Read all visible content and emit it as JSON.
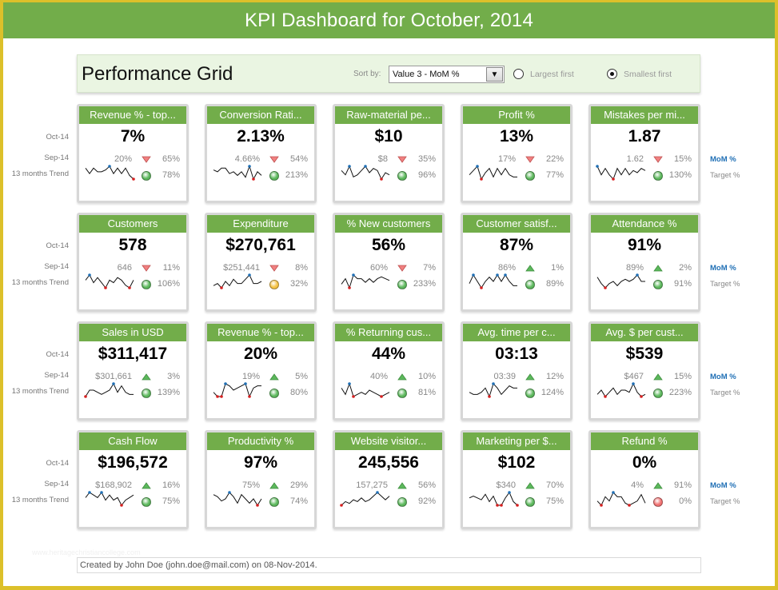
{
  "title": "KPI Dashboard for October, 2014",
  "performance": {
    "title": "Performance Grid",
    "sort_label": "Sort by:",
    "sort_value": "Value 3 - MoM %",
    "options": [
      {
        "label": "Largest first",
        "selected": false
      },
      {
        "label": "Smallest first",
        "selected": true
      }
    ]
  },
  "row_labels": {
    "current": "Oct-14",
    "previous": "Sep-14",
    "trend": "13 months Trend"
  },
  "legend": {
    "mom": "MoM %",
    "target": "Target %"
  },
  "colors": {
    "accent_green": "#72ad4a",
    "up": "#5cb85c",
    "down": "#f08080",
    "target_good": "#5cb85c",
    "target_warn": "#f5c242",
    "target_bad": "#f07070",
    "spark_high": "#1f6fb5",
    "spark_low": "#d62020",
    "frame": "#dcc02a"
  },
  "cards": [
    {
      "title": "Revenue % - top...",
      "value": "7%",
      "previous": "20%",
      "mom_dir": "down",
      "mom": "65%",
      "target_status": "good",
      "target": "78%",
      "trend": [
        6,
        3,
        6,
        4,
        4,
        5,
        7,
        3,
        6,
        3,
        6,
        2,
        0
      ]
    },
    {
      "title": "Conversion Rati...",
      "value": "2.13%",
      "previous": "4.66%",
      "mom_dir": "down",
      "mom": "54%",
      "target_status": "good",
      "target": "213%",
      "trend": [
        5,
        4,
        6,
        6,
        3,
        4,
        2,
        4,
        1,
        7,
        0,
        4,
        2
      ]
    },
    {
      "title": "Raw-material pe...",
      "value": "$10",
      "previous": "$8",
      "mom_dir": "down",
      "mom": "35%",
      "target_status": "good",
      "target": "96%",
      "trend": [
        5,
        3,
        7,
        2,
        3,
        5,
        7,
        4,
        6,
        5,
        1,
        4,
        3
      ]
    },
    {
      "title": "Profit %",
      "value": "13%",
      "previous": "17%",
      "mom_dir": "down",
      "mom": "22%",
      "target_status": "good",
      "target": "77%",
      "trend": [
        3,
        5,
        7,
        1,
        4,
        6,
        2,
        6,
        3,
        6,
        3,
        2,
        2
      ]
    },
    {
      "title": "Mistakes per mi...",
      "value": "1.87",
      "previous": "1.62",
      "mom_dir": "down",
      "mom": "15%",
      "target_status": "good",
      "target": "130%",
      "trend": [
        7,
        3,
        6,
        3,
        1,
        6,
        3,
        6,
        3,
        5,
        4,
        6,
        5
      ]
    },
    {
      "title": "Customers",
      "value": "578",
      "previous": "646",
      "mom_dir": "down",
      "mom": "11%",
      "target_status": "good",
      "target": "106%",
      "trend": [
        4,
        6,
        3,
        5,
        3,
        1,
        4,
        3,
        5,
        4,
        2,
        1,
        4
      ]
    },
    {
      "title": "Expenditure",
      "value": "$270,761",
      "previous": "$251,441",
      "mom_dir": "down",
      "mom": "8%",
      "target_status": "warn",
      "target": "32%",
      "trend": [
        2,
        3,
        1,
        4,
        2,
        5,
        3,
        3,
        5,
        7,
        3,
        3,
        4
      ]
    },
    {
      "title": "% New customers",
      "value": "56%",
      "previous": "60%",
      "mom_dir": "down",
      "mom": "7%",
      "target_status": "good",
      "target": "233%",
      "trend": [
        2,
        5,
        0,
        7,
        5,
        5,
        3,
        5,
        3,
        5,
        6,
        5,
        4
      ]
    },
    {
      "title": "Customer satisf...",
      "value": "87%",
      "previous": "86%",
      "mom_dir": "up",
      "mom": "1%",
      "target_status": "good",
      "target": "89%",
      "trend": [
        2,
        6,
        3,
        0,
        3,
        5,
        3,
        6,
        3,
        6,
        3,
        1,
        1
      ]
    },
    {
      "title": "Attendance %",
      "value": "91%",
      "previous": "89%",
      "mom_dir": "up",
      "mom": "2%",
      "target_status": "good",
      "target": "91%",
      "trend": [
        5,
        2,
        0,
        2,
        3,
        1,
        3,
        4,
        3,
        4,
        6,
        3,
        3
      ]
    },
    {
      "title": "Sales in USD",
      "value": "$311,417",
      "previous": "$301,661",
      "mom_dir": "up",
      "mom": "3%",
      "target_status": "good",
      "target": "139%",
      "trend": [
        0,
        3,
        3,
        2,
        1,
        2,
        3,
        6,
        2,
        5,
        2,
        1,
        1
      ]
    },
    {
      "title": "Revenue % - top...",
      "value": "20%",
      "previous": "19%",
      "mom_dir": "up",
      "mom": "5%",
      "target_status": "good",
      "target": "80%",
      "trend": [
        2,
        0,
        0,
        6,
        5,
        3,
        4,
        5,
        6,
        0,
        4,
        5,
        5
      ]
    },
    {
      "title": "% Returning cus...",
      "value": "44%",
      "previous": "40%",
      "mom_dir": "up",
      "mom": "10%",
      "target_status": "good",
      "target": "81%",
      "trend": [
        4,
        1,
        6,
        0,
        1,
        2,
        1,
        3,
        2,
        1,
        0,
        1,
        2
      ]
    },
    {
      "title": "Avg. time per c...",
      "value": "03:13",
      "previous": "03:39",
      "mom_dir": "up",
      "mom": "12%",
      "target_status": "good",
      "target": "124%",
      "trend": [
        2,
        1,
        1,
        2,
        4,
        0,
        6,
        4,
        1,
        3,
        5,
        4,
        4
      ]
    },
    {
      "title": "Avg. $ per cust...",
      "value": "$539",
      "previous": "$467",
      "mom_dir": "up",
      "mom": "15%",
      "target_status": "good",
      "target": "223%",
      "trend": [
        2,
        4,
        1,
        3,
        5,
        2,
        4,
        4,
        3,
        7,
        3,
        1,
        2
      ]
    },
    {
      "title": "Cash Flow",
      "value": "$196,572",
      "previous": "$168,902",
      "mom_dir": "up",
      "mom": "16%",
      "target_status": "good",
      "target": "75%",
      "trend": [
        3,
        5,
        4,
        3,
        5,
        2,
        4,
        2,
        3,
        0,
        2,
        3,
        4
      ]
    },
    {
      "title": "Productivity %",
      "value": "97%",
      "previous": "75%",
      "mom_dir": "up",
      "mom": "29%",
      "target_status": "good",
      "target": "74%",
      "trend": [
        5,
        4,
        2,
        3,
        6,
        4,
        1,
        5,
        3,
        1,
        3,
        0,
        3
      ]
    },
    {
      "title": "Website visitor...",
      "value": "245,556",
      "previous": "157,275",
      "mom_dir": "up",
      "mom": "56%",
      "target_status": "good",
      "target": "92%",
      "trend": [
        0,
        2,
        1,
        3,
        2,
        4,
        2,
        3,
        5,
        7,
        5,
        3,
        5
      ]
    },
    {
      "title": "Marketing per $...",
      "value": "$102",
      "previous": "$340",
      "mom_dir": "up",
      "mom": "70%",
      "target_status": "good",
      "target": "75%",
      "trend": [
        4,
        5,
        4,
        3,
        6,
        2,
        5,
        0,
        0,
        4,
        7,
        2,
        0
      ]
    },
    {
      "title": "Refund %",
      "value": "0%",
      "previous": "4%",
      "mom_dir": "up",
      "mom": "91%",
      "target_status": "bad",
      "target": "0%",
      "trend": [
        2,
        0,
        4,
        2,
        6,
        4,
        4,
        1,
        0,
        1,
        2,
        5,
        1
      ]
    }
  ],
  "footer": "Created by John Doe (john.doe@mail.com) on 08-Nov-2014.",
  "watermark": "www.heritagechristiancollege.com"
}
